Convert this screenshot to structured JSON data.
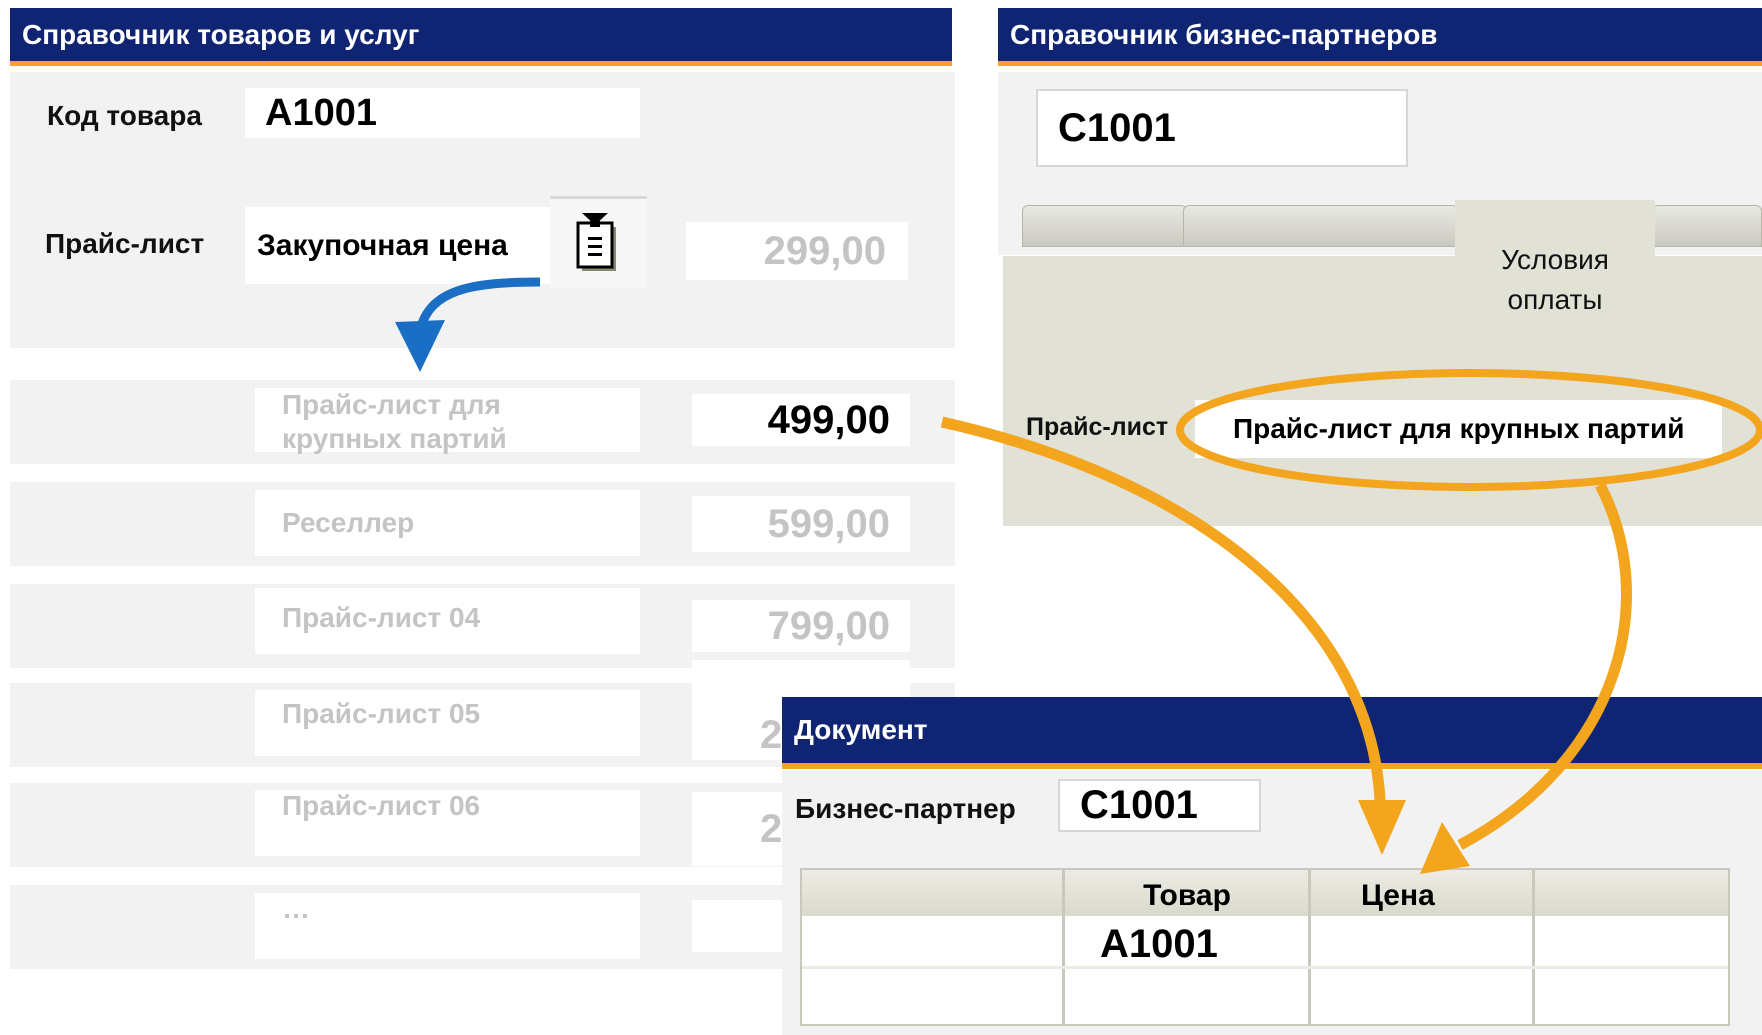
{
  "products_window": {
    "title": "Справочник товаров и услуг",
    "item_code_label": "Код товара",
    "item_code_value": "A1001",
    "price_list_label": "Прайс-лист",
    "price_list_value": "Закупочная цена",
    "price_value": "299,00",
    "list_rows": [
      {
        "name": "Прайс-лист для\nкрупных партий",
        "price": "499,00"
      },
      {
        "name": "Реселлер",
        "price": "599,00"
      },
      {
        "name": "Прайс-лист 04",
        "price": "799,00"
      },
      {
        "name": "Прайс-лист 05",
        "price": "2"
      },
      {
        "name": "Прайс-лист 06",
        "price": "2"
      },
      {
        "name": "…",
        "price": ""
      }
    ]
  },
  "partners_window": {
    "title": "Справочник бизнес-партнеров",
    "code_value": "C1001",
    "tab_label": "Условия\nоплаты",
    "price_list_label": "Прайс-лист",
    "price_list_value": "Прайс-лист для крупных партий"
  },
  "document_window": {
    "title": "Документ",
    "partner_label": "Бизнес-партнер",
    "partner_value": "C1001",
    "table": {
      "columns": [
        "",
        "Товар",
        "Цена",
        ""
      ],
      "rows": [
        [
          "",
          "A1001",
          "",
          ""
        ],
        [
          "",
          "",
          "",
          ""
        ]
      ]
    }
  },
  "colors": {
    "title_bar": "#0f2472",
    "accent": "#f3a51d",
    "blue_arrow": "#1a6fc4",
    "faded_text": "#c4c4c4"
  },
  "icons": [
    "dropdown-list-icon"
  ]
}
